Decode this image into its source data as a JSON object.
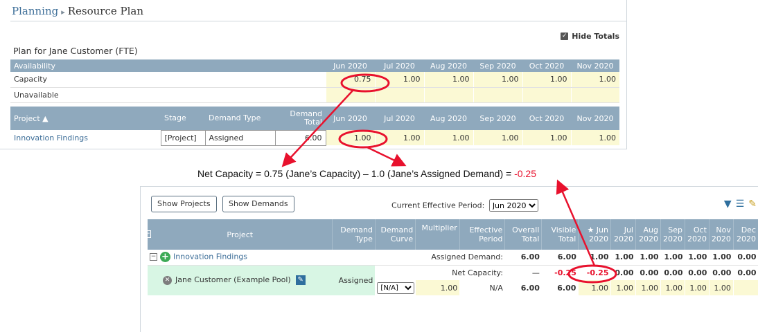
{
  "breadcrumb": {
    "parent": "Planning",
    "separator": "▸",
    "current": "Resource Plan"
  },
  "hide_totals": {
    "label": "Hide Totals",
    "checked": true
  },
  "plan_title": "Plan for Jane Customer (FTE)",
  "months": [
    "Jun 2020",
    "Jul 2020",
    "Aug 2020",
    "Sep 2020",
    "Oct 2020",
    "Nov 2020"
  ],
  "availability": {
    "header": "Availability",
    "rows": [
      {
        "label": "Capacity",
        "values": [
          "0.75",
          "1.00",
          "1.00",
          "1.00",
          "1.00",
          "1.00"
        ]
      },
      {
        "label": "Unavailable",
        "values": [
          "",
          "",
          "",
          "",
          "",
          ""
        ]
      }
    ]
  },
  "projects_table": {
    "headers": {
      "project": "Project ▲",
      "stage": "Stage",
      "demand_type": "Demand Type",
      "demand_total": "Demand Total"
    },
    "rows": [
      {
        "project": "Innovation Findings",
        "stage": "[Project]",
        "demand_type": "Assigned",
        "demand_total": "6.00",
        "values": [
          "1.00",
          "1.00",
          "1.00",
          "1.00",
          "1.00",
          "1.00"
        ]
      }
    ]
  },
  "formula": {
    "text": "Net Capacity = 0.75 (Jane’s Capacity) – 1.0 (Jane’s Assigned Demand) = ",
    "result": "-0.25"
  },
  "bottom": {
    "buttons": {
      "show_projects": "Show Projects",
      "show_demands": "Show Demands"
    },
    "period_label": "Current Effective Period:",
    "period_value": "Jun 2020",
    "icons": [
      "filter-icon",
      "columns-icon",
      "edit-icon"
    ],
    "headers": {
      "project": "Project",
      "demand_type": "Demand Type",
      "demand_curve": "Demand Curve",
      "multiplier": "Multiplier",
      "effective_period": "Effective Period",
      "overall_total": "Overall Total",
      "visible_total": "Visible Total",
      "months": [
        "★ Jun 2020",
        "Jul 2020",
        "Aug 2020",
        "Sep 2020",
        "Oct 2020",
        "Nov 2020",
        "Dec 2020"
      ]
    },
    "project_row": {
      "name": "Innovation Findings",
      "label": "Assigned Demand:",
      "overall_total": "6.00",
      "visible_total": "6.00",
      "values": [
        "1.00",
        "1.00",
        "1.00",
        "1.00",
        "1.00",
        "1.00",
        "0.00"
      ]
    },
    "resource_row": {
      "name": "Jane Customer (Example Pool)",
      "demand_type": "Assigned",
      "net_label": "Net Capacity:",
      "net_overall": "—",
      "net_visible": "-0.25",
      "net_values": [
        "-0.25",
        "0.00",
        "0.00",
        "0.00",
        "0.00",
        "0.00",
        "0.00"
      ],
      "curve": "[N/A]",
      "multiplier": "1.00",
      "effective_period": "N/A",
      "overall_total": "6.00",
      "visible_total": "6.00",
      "values": [
        "1.00",
        "1.00",
        "1.00",
        "1.00",
        "1.00",
        "1.00",
        ""
      ]
    }
  },
  "colors": {
    "header_bg": "#8fa9bd",
    "highlight_red": "#e8112d",
    "cell_yellow": "#fbf9d4",
    "row_green": "#d8f6e4",
    "link_blue": "#3d6e98"
  }
}
